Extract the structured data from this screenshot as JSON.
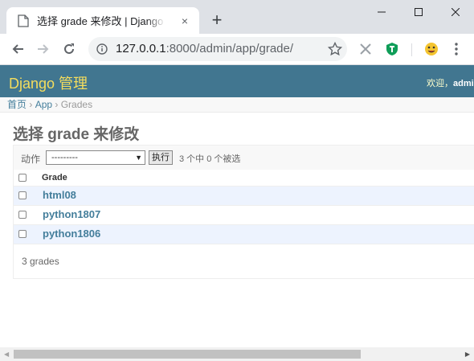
{
  "browser": {
    "tab_title": "选择 grade 来修改 | Django 站点管理",
    "tab_close": "×",
    "new_tab": "+",
    "url_host": "127.0.0.1",
    "url_rest": ":8000/admin/app/grade/"
  },
  "header": {
    "brand": "Django 管理",
    "welcome": "欢迎，",
    "user": "admin"
  },
  "breadcrumbs": {
    "home": "首页",
    "sep1": " › ",
    "app": "App",
    "sep2": " › ",
    "current": "Grades"
  },
  "page_title": "选择 grade 来修改",
  "actions": {
    "label": "动作",
    "selected": "---------",
    "go": "执行",
    "counter": "3 个中 0 个被选"
  },
  "table": {
    "column": "Grade",
    "rows": [
      "html08",
      "python1807",
      "python1806"
    ]
  },
  "paginator": "3 grades",
  "colors": {
    "header_bg": "#417690",
    "brand": "#f5dd5d",
    "link": "#447e9b",
    "row_alt": "#edf3fe"
  }
}
